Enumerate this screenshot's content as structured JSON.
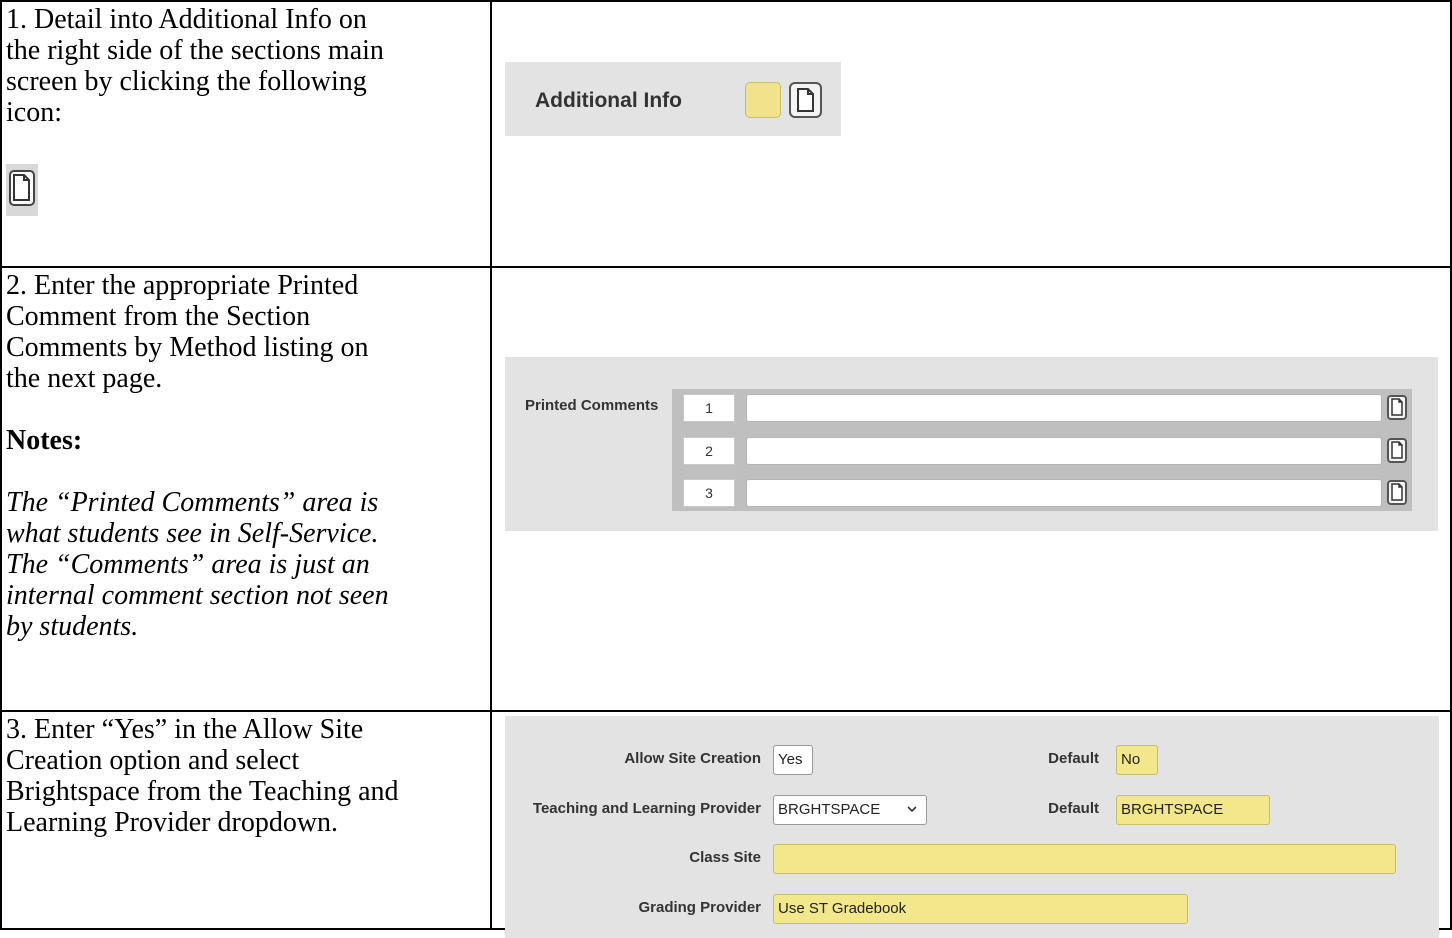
{
  "row1": {
    "instruction_lines": [
      "1. Detail into Additional Info on",
      "the right side of the sections main",
      "screen by clicking the following",
      "icon:"
    ],
    "icon_left": "document-icon",
    "screenshot": {
      "label": "Additional Info",
      "swatch_color": "#f0e38c",
      "icon": "document-icon"
    }
  },
  "row2": {
    "instruction_lines": [
      "2. Enter the appropriate Printed",
      "Comment from the Section",
      "Comments by Method listing on",
      "the next page."
    ],
    "notes_heading": "Notes:",
    "notes_lines": [
      "The “Printed Comments” area is",
      "what students see in Self-Service.",
      "The “Comments” area is just an",
      "internal comment section not seen",
      "by students."
    ],
    "screenshot": {
      "label": "Printed Comments",
      "rows": [
        {
          "number": "1",
          "value": ""
        },
        {
          "number": "2",
          "value": ""
        },
        {
          "number": "3",
          "value": ""
        }
      ]
    }
  },
  "row3": {
    "instruction_lines": [
      "3. Enter “Yes” in the Allow Site",
      "Creation option and select",
      "Brightspace from the Teaching and",
      "Learning Provider dropdown."
    ],
    "screenshot": {
      "allow_site_creation_label": "Allow Site Creation",
      "allow_site_creation_value": "Yes",
      "default_label_1": "Default",
      "default_value_1": "No",
      "tlp_label": "Teaching and Learning Provider",
      "tlp_value": "BRGHTSPACE",
      "default_label_2": "Default",
      "default_value_2": "BRGHTSPACE",
      "class_site_label": "Class Site",
      "class_site_value": "",
      "grading_provider_label": "Grading Provider",
      "grading_provider_value": "Use ST Gradebook",
      "dropdown_icon": "chevron-down-icon",
      "highlight_color": "#f3e78c"
    }
  }
}
